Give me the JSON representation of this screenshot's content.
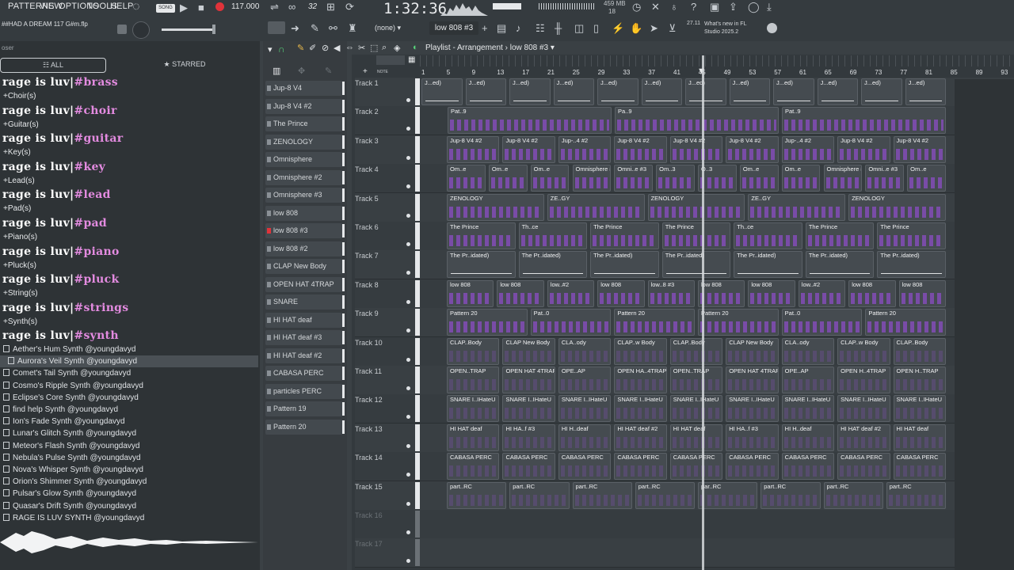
{
  "menu": [
    "PATTERNS",
    "VIEW",
    "OPTIONS",
    "TOOLS",
    "HELP"
  ],
  "toolbar": {
    "song_mode": "SONG",
    "tempo": "117.000",
    "pattern_number": "32",
    "time": "1:32:36",
    "cpu_mem": "459 MB",
    "cpu_sub": "18",
    "project_file": "##HAD A DREAM 117 G#m.flp",
    "none_select": "(none)",
    "pattern_select": "low 808 #3",
    "news_date": "27.11",
    "news_text": "What's new in FL Studio 2025.2"
  },
  "browser": {
    "header": "oser",
    "tab_all": "ALL",
    "tab_starred": "STARRED",
    "categories": [
      {
        "prefix": "rage is luv|",
        "tag": "#brass",
        "sub": "+Choir(s)"
      },
      {
        "prefix": "rage is luv|",
        "tag": "#choir",
        "sub": "+Guitar(s)"
      },
      {
        "prefix": "rage is luv|",
        "tag": "#guitar",
        "sub": "+Key(s)"
      },
      {
        "prefix": "rage is luv|",
        "tag": "#key",
        "sub": "+Lead(s)"
      },
      {
        "prefix": "rage is luv|",
        "tag": "#lead",
        "sub": "+Pad(s)"
      },
      {
        "prefix": "rage is luv|",
        "tag": "#pad",
        "sub": "+Piano(s)"
      },
      {
        "prefix": "rage is luv|",
        "tag": "#piano",
        "sub": "+Pluck(s)"
      },
      {
        "prefix": "rage is luv|",
        "tag": "#pluck",
        "sub": "+String(s)"
      },
      {
        "prefix": "rage is luv|",
        "tag": "#strings",
        "sub": "+Synth(s)"
      },
      {
        "prefix": "rage is luv|",
        "tag": "#synth",
        "sub": ""
      }
    ],
    "files": [
      "Aether's Hum Synth @youngdavyd",
      "Aurora's Veil Synth @youngdavyd",
      "Comet's Tail Synth @youngdavyd",
      "Cosmo's Ripple Synth @youngdavyd",
      "Eclipse's Core Synth @youngdavyd",
      "find help Synth @youngdavyd",
      "Ion's Fade Synth @youngdavyd",
      "Lunar's Glitch Synth @youngdavyd",
      "Meteor's Flash Synth @youngdavyd",
      "Nebula's Pulse Synth @youngdavyd",
      "Nova's Whisper Synth @youngdavyd",
      "Orion's Shimmer Synth @youngdavyd",
      "Pulsar's Glow Synth @youngdavyd",
      "Quasar's Drift Synth @youngdavyd",
      "RAGE IS LUV SYNTH @youngdavyd"
    ],
    "selected_file_index": 1
  },
  "channels": [
    "Jup-8 V4",
    "Jup-8 V4 #2",
    "The Prince",
    "ZENOLOGY",
    "Omnisphere",
    "Omnisphere #2",
    "Omnisphere #3",
    "low 808",
    "low 808 #3",
    "low 808 #2",
    "CLAP New Body",
    "OPEN HAT 4TRAP",
    "SNARE IloveUIHateU",
    "HI HAT deaf",
    "HI HAT deaf #3",
    "HI HAT deaf #2",
    "CABASA PERC",
    "particles PERC",
    "Pattern 19",
    "Pattern 20"
  ],
  "playlist": {
    "title": "Playlist - Arrangement",
    "pattern": "low 808 #3",
    "ruler": [
      "1",
      "5",
      "9",
      "13",
      "17",
      "21",
      "25",
      "29",
      "33",
      "37",
      "41",
      "45",
      "49",
      "53",
      "57",
      "61",
      "65",
      "69",
      "73",
      "77",
      "81",
      "85",
      "89",
      "93"
    ],
    "tracks": [
      {
        "name": "Track 1",
        "clips": [
          "J...ed)",
          "J...ed)",
          "J...ed)",
          "J...ed)",
          "J...ed)",
          "J...ed)",
          "J...ed)",
          "J...ed)",
          "J...ed)",
          "J...ed)",
          "J...ed)",
          "J...ed)"
        ]
      },
      {
        "name": "Track 2",
        "clips": [
          "Pat..9",
          "Pa..9",
          "Pat..9"
        ]
      },
      {
        "name": "Track 3",
        "clips": [
          "Jup-8 V4 #2",
          "Jup-8 V4 #2",
          "Jup-..4 #2",
          "Jup-8 V4 #2",
          "Jup-8 V4 #2",
          "Jup-8 V4 #2",
          "Jup-..4 #2",
          "Jup-8 V4 #2",
          "Jup-8 V4 #2"
        ]
      },
      {
        "name": "Track 4",
        "clips": [
          "Om..e",
          "Om..e",
          "Om..e",
          "Omnisphere #2",
          "Omni..e #3",
          "Om..3",
          "O..3",
          "Om..e",
          "Om..e",
          "Omnisphere #2",
          "Omni..e #3",
          "Om..e"
        ]
      },
      {
        "name": "Track 5",
        "clips": [
          "ZENOLOGY",
          "ZE..GY",
          "ZENOLOGY",
          "ZE..GY",
          "ZENOLOGY"
        ]
      },
      {
        "name": "Track 6",
        "clips": [
          "The Prince",
          "Th..ce",
          "The Prince",
          "The Prince",
          "Th..ce",
          "The Prince",
          "The Prince"
        ]
      },
      {
        "name": "Track 7",
        "clips": [
          "The Pr..idated)",
          "The Pr..idated)",
          "The Pr..idated)",
          "The Pr..idated)",
          "The Pr..idated)",
          "The Pr..idated)",
          "The Pr..idated)"
        ]
      },
      {
        "name": "Track 8",
        "clips": [
          "low 808",
          "low 808",
          "low..#2",
          "low 808",
          "low..8 #3",
          "low 808",
          "low 808",
          "low..#2",
          "low 808",
          "low 808"
        ]
      },
      {
        "name": "Track 9",
        "clips": [
          "Pattern 20",
          "Pat..0",
          "Pattern 20",
          "Pattern 20",
          "Pat..0",
          "Pattern 20"
        ]
      },
      {
        "name": "Track 10",
        "clips": [
          "CLAP..Body",
          "CLAP New Body",
          "CLA..ody",
          "CLAP..w Body",
          "CLAP..Body",
          "CLAP New Body",
          "CLA..ody",
          "CLAP..w Body",
          "CLAP..Body"
        ]
      },
      {
        "name": "Track 11",
        "clips": [
          "OPEN..TRAP",
          "OPEN HAT 4TRAP",
          "OPE..AP",
          "OPEN HA..4TRAP",
          "OPEN..TRAP",
          "OPEN HAT 4TRAP",
          "OPE..AP",
          "OPEN H..4TRAP",
          "OPEN H..TRAP"
        ]
      },
      {
        "name": "Track 12",
        "clips": [
          "SNARE I..IHateU",
          "SNARE I..IHateU",
          "SNARE I..IHateU",
          "SNARE I..IHateU",
          "SNARE I..IHateU",
          "SNARE I..IHateU",
          "SNARE I..IHateU",
          "SNARE I..IHateU",
          "SNARE I..IHateU"
        ]
      },
      {
        "name": "Track 13",
        "clips": [
          "HI HAT deaf",
          "HI HA..f #3",
          "HI H..deaf",
          "HI HAT deaf #2",
          "HI HAT deaf",
          "HI HA..f #3",
          "HI H..deaf",
          "HI HAT deaf #2",
          "HI HAT deaf"
        ]
      },
      {
        "name": "Track 14",
        "clips": [
          "CABASA PERC",
          "CABASA PERC",
          "CABASA PERC",
          "CABASA PERC",
          "CABASA PERC",
          "CABASA PERC",
          "CABASA PERC",
          "CABASA PERC",
          "CABASA PERC"
        ]
      },
      {
        "name": "Track 15",
        "clips": [
          "part..RC",
          "part..RC",
          "part..RC",
          "part..RC",
          "par..RC",
          "part..RC",
          "part..RC",
          "part..RC"
        ]
      },
      {
        "name": "Track 16",
        "clips": []
      },
      {
        "name": "Track 17",
        "clips": []
      }
    ]
  },
  "colors": {
    "accent_pink": "#e38be0",
    "note_purple": "#8a4dc4",
    "record_red": "#e0333a"
  }
}
